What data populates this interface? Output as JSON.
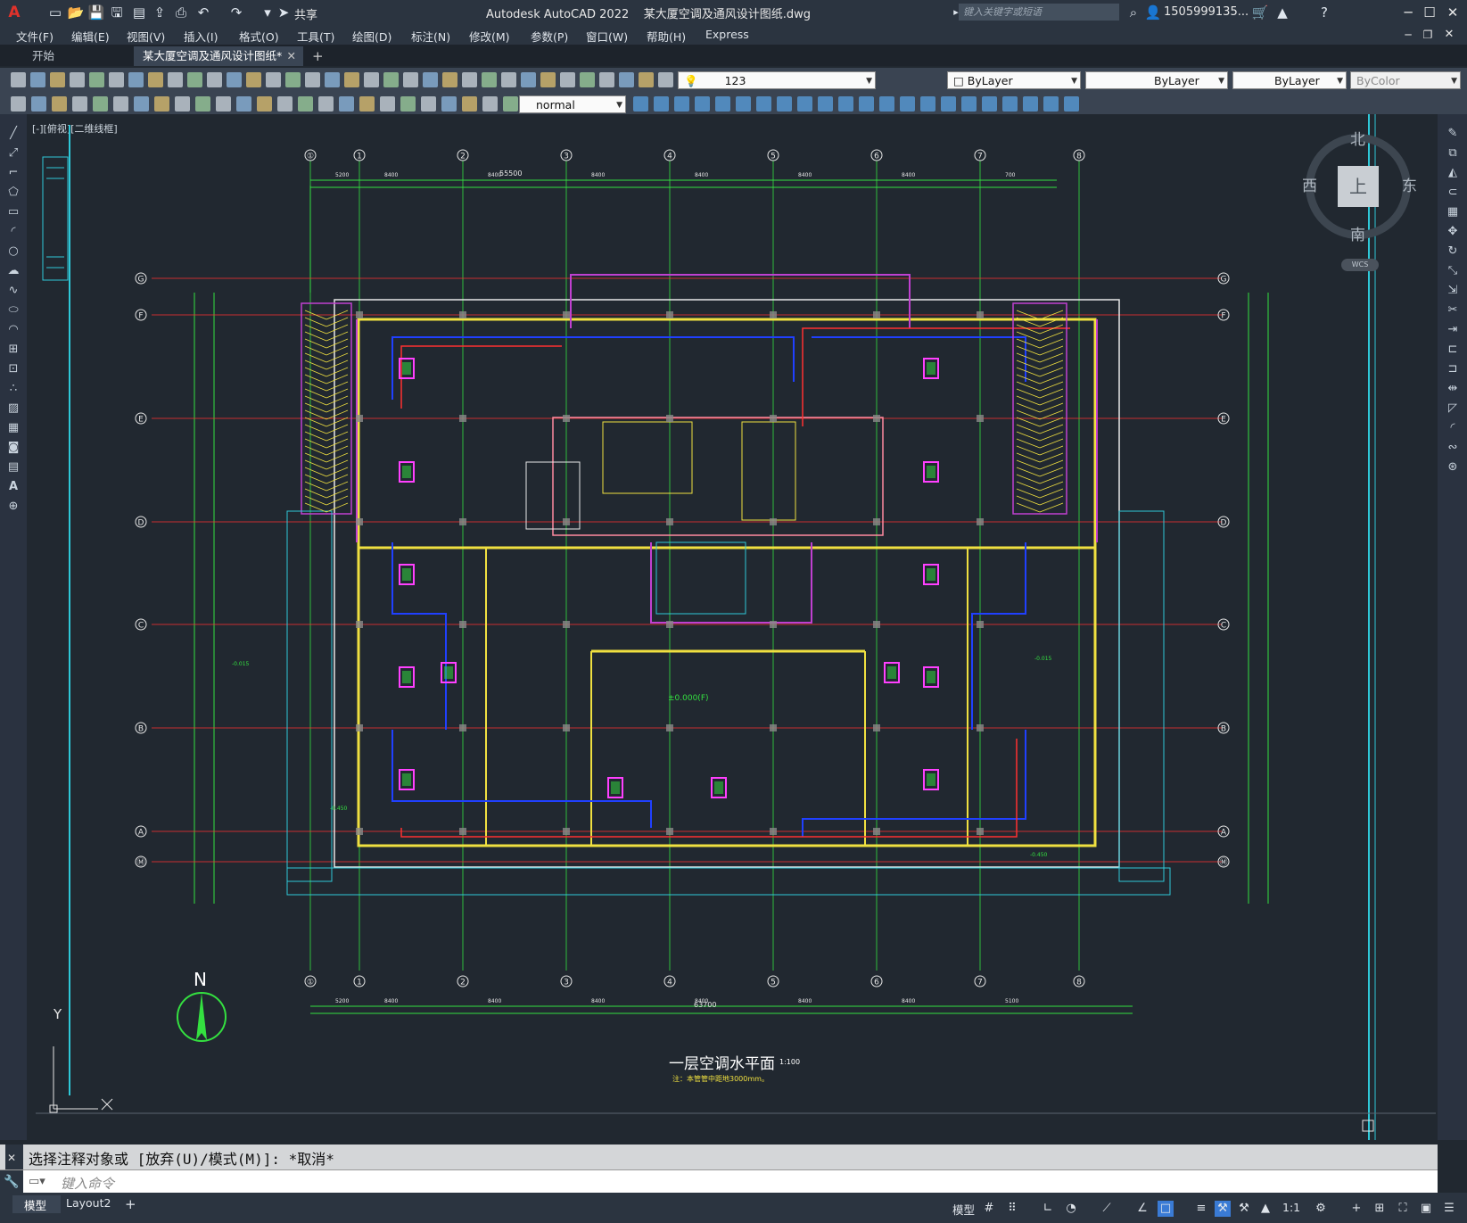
{
  "titlebar": {
    "app_title": "Autodesk AutoCAD 2022    某大厦空调及通风设计图纸.dwg",
    "share_label": "共享",
    "search_placeholder": "键入关键字或短语",
    "user_name": "1505999135..."
  },
  "menu": [
    "文件(F)",
    "编辑(E)",
    "视图(V)",
    "插入(I)",
    "格式(O)",
    "工具(T)",
    "绘图(D)",
    "标注(N)",
    "修改(M)",
    "参数(P)",
    "窗口(W)",
    "帮助(H)",
    "Express"
  ],
  "tabs": {
    "start": "开始",
    "drawing": "某大厦空调及通风设计图纸*",
    "add": "+"
  },
  "properties": {
    "layer": "123",
    "color": "ByLayer",
    "linetype": "ByLayer",
    "lineweight": "ByLayer",
    "plotstyle": "ByColor",
    "text_style": "normal"
  },
  "viewport_label": "[-][俯视][二维线框]",
  "viewcube": {
    "north": "北",
    "south": "南",
    "east": "东",
    "west": "西",
    "top": "上",
    "wcs": "WCS"
  },
  "drawing": {
    "title": "一层空调水平面",
    "scale": "1:100",
    "note": "注：本管管中距地3000mm。",
    "north_label": "N",
    "ucs_y": "Y",
    "top_dim_total": "55500",
    "bottom_dim_total": "63700",
    "grid_cols": [
      "①",
      "1",
      "2",
      "3",
      "4",
      "5",
      "6",
      "7",
      "8"
    ],
    "grid_rows": [
      "G",
      "F",
      "E",
      "D",
      "C",
      "B",
      "A",
      "Ⓜ"
    ],
    "dims_top": [
      "5200",
      "8400",
      "8400",
      "8400",
      "8400",
      "8400",
      "8400",
      "700"
    ],
    "dims_bottom": [
      "5200",
      "8400",
      "8400",
      "8400",
      "8400",
      "8400",
      "8400",
      "5100"
    ],
    "elevations": [
      "±0.000(F)",
      "-0.015",
      "-0.450",
      "-0.015",
      "-0.450"
    ]
  },
  "command": {
    "history": "选择注释对象或 [放弃(U)/模式(M)]: *取消*",
    "placeholder": "键入命令"
  },
  "status": {
    "tab_model": "模型",
    "tab_layout": "Layout2",
    "model_label": "模型",
    "scale": "1:1"
  }
}
